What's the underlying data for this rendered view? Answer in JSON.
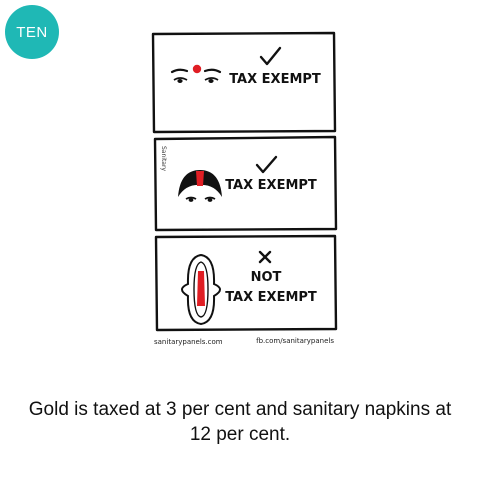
{
  "badge": {
    "label": "TEN",
    "color": "#1fb8b5"
  },
  "comic": {
    "panels": [
      {
        "mark_icon": "check-icon",
        "label": "TAX EXEMPT",
        "subject_icon": "bindi-eyes-icon"
      },
      {
        "mark_icon": "check-icon",
        "label": "TAX EXEMPT",
        "subject_icon": "sindoor-hair-icon"
      },
      {
        "mark_icon": "cross-icon",
        "label_top": "NOT",
        "label": "TAX EXEMPT",
        "subject_icon": "sanitary-pad-icon"
      }
    ],
    "side_signature": "Sanitary",
    "credit_left": "sanitarypanels.com",
    "credit_right": "fb.com/sanitarypanels"
  },
  "caption": "Gold is taxed at 3 per cent and sanitary napkins at 12 per cent."
}
